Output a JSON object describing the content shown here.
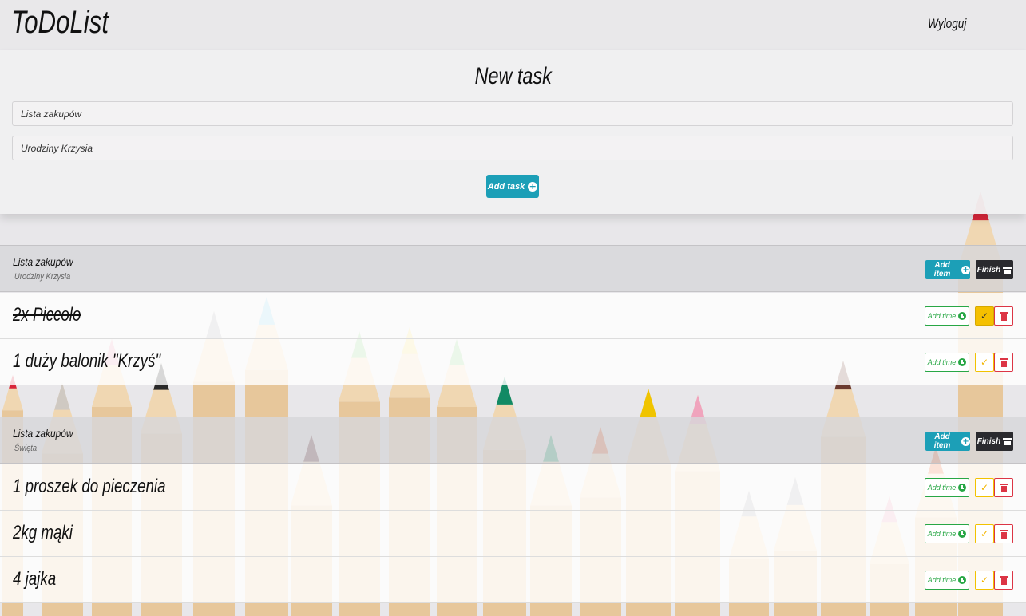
{
  "navbar": {
    "brand": "ToDoList",
    "logout": "Wyloguj"
  },
  "new_task": {
    "title": "New task",
    "title_field_value": "Lista zakupów",
    "description_field_value": "Urodziny Krzysia",
    "add_button_label": "Add task"
  },
  "lists": [
    {
      "title": "Lista zakupów",
      "subtitle": "Urodziny Krzysia",
      "add_item_label": "Add item",
      "finish_label": "Finish",
      "items": [
        {
          "text": "2x Piccolo",
          "add_time_label": "Add time",
          "done": true
        },
        {
          "text": "1 duży balonik \"Krzyś\"",
          "add_time_label": "Add time",
          "done": false
        }
      ]
    },
    {
      "title": "Lista zakupów",
      "subtitle": "Święta",
      "add_item_label": "Add item",
      "finish_label": "Finish",
      "items": [
        {
          "text": "1 proszek do pieczenia",
          "add_time_label": "Add time",
          "done": false
        },
        {
          "text": "2kg mąki",
          "add_time_label": "Add time",
          "done": false
        },
        {
          "text": "4 jajka",
          "add_time_label": "Add time",
          "done": false
        }
      ]
    }
  ],
  "colors": {
    "primary": "#1c9fb7",
    "dark": "#2a2a2e",
    "success": "#28a745",
    "warning": "#f5c000",
    "danger": "#dc3545"
  },
  "icons": {
    "add": "plus-circle-icon",
    "finish": "archive-icon",
    "time": "clock-icon",
    "check": "check-icon",
    "delete": "trash-icon"
  }
}
